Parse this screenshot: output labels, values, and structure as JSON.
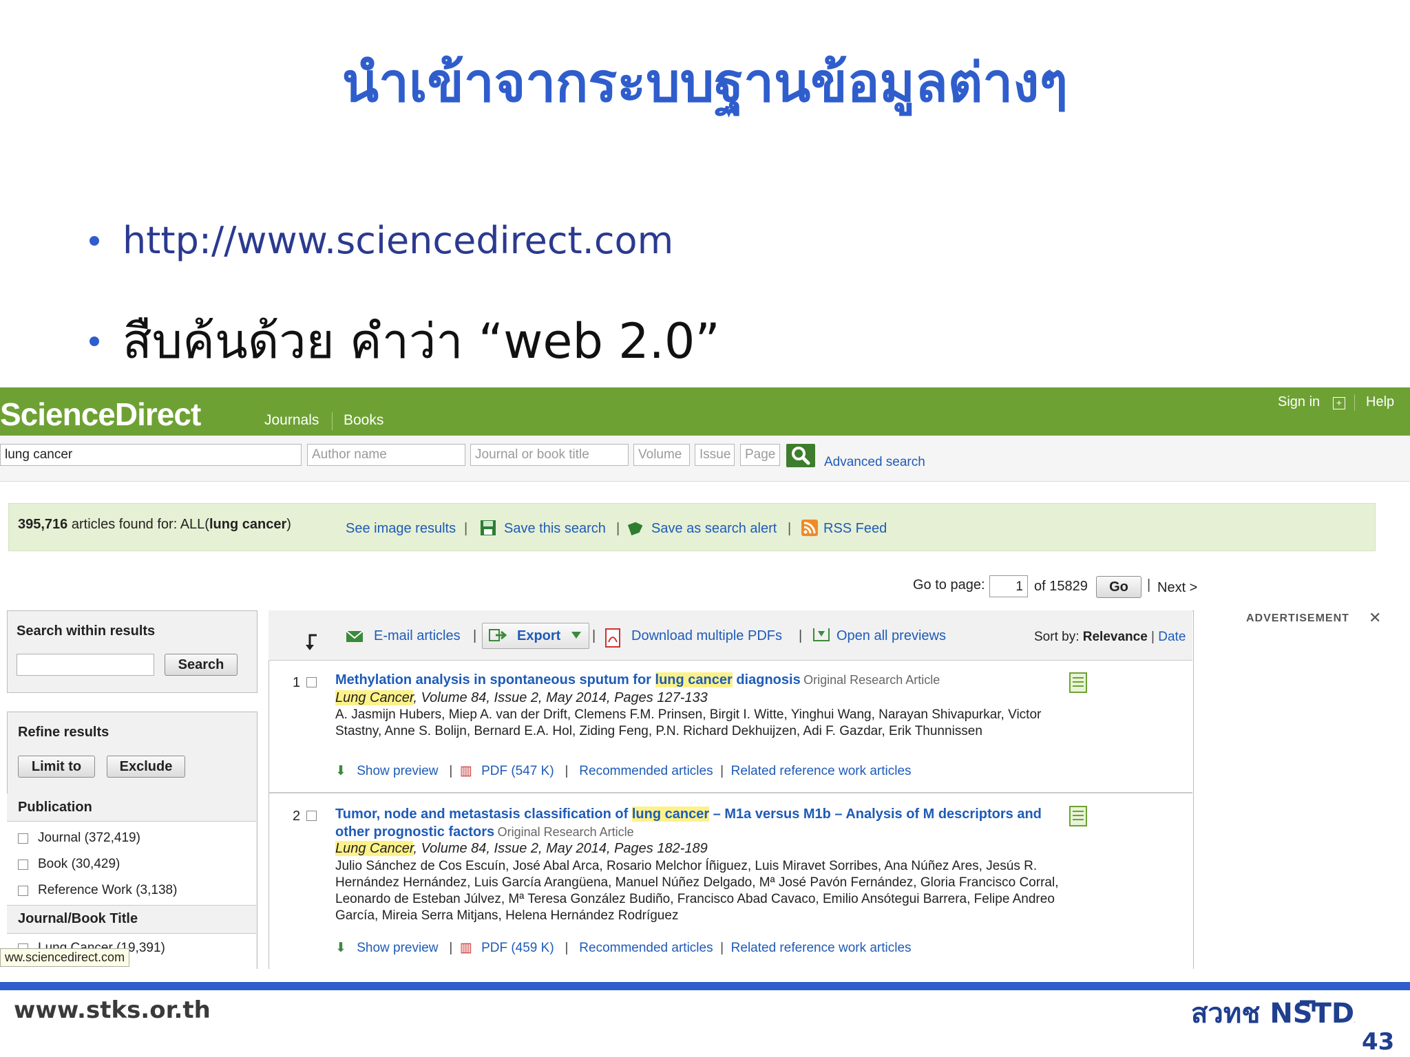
{
  "slide": {
    "title": "นำเข้าจากระบบฐานข้อมูลต่างๆ",
    "bullets": [
      "http://www.sciencedirect.com",
      "สืบค้นด้วย คำว่า “web 2.0”"
    ],
    "footer_url": "www.stks.or.th",
    "logo_text": "สวทช NSTDA",
    "page_number": "43"
  },
  "colors": {
    "title_blue": "#2f5dcc",
    "sd_green": "#6ea134",
    "link_blue": "#1e5bb8",
    "highlight": "#fdf28a"
  },
  "sd": {
    "logo": "ScienceDirect",
    "nav": [
      "Journals",
      "Books"
    ],
    "sign_in": "Sign in",
    "help": "Help",
    "search": {
      "terms_value": "lung cancer",
      "author_placeholder": "Author name",
      "journal_placeholder": "Journal or book title",
      "volume_placeholder": "Volume",
      "issue_placeholder": "Issue",
      "page_placeholder": "Page",
      "advanced": "Advanced search",
      "search_icon": "magnifier-icon"
    },
    "result_bar": {
      "count": "395,716",
      "found_for": " articles found for: ALL(",
      "query": "lung cancer",
      "close_paren": ")",
      "image_results": "See image results",
      "save_search": "Save this search",
      "save_alert": "Save as search alert",
      "rss": "RSS Feed"
    },
    "pager": {
      "go_to_page": "Go to page:",
      "current": "1",
      "of_total": "of 15829",
      "go": "Go",
      "next": "Next >"
    },
    "sidebar": {
      "within_title": "Search within results",
      "search_btn": "Search",
      "refine_title": "Refine results",
      "limit_btn": "Limit to",
      "exclude_btn": "Exclude",
      "publication_title": "Publication",
      "publication_items": [
        "Journal (372,419)",
        "Book (30,429)",
        "Reference Work (3,138)"
      ],
      "journal_title": "Journal/Book Title",
      "journal_items": [
        "Lung Cancer (19,391)"
      ]
    },
    "toolbar": {
      "email": "E-mail articles",
      "export": "Export",
      "download_pdfs": "Download multiple PDFs",
      "open_previews": "Open all previews",
      "sort_by": "Sort by: ",
      "relevance": "Relevance",
      "date": "Date"
    },
    "advertisement": "ADVERTISEMENT",
    "results": [
      {
        "num": "1",
        "title_pre": "Methylation analysis in spontaneous sputum for ",
        "title_hl": "lung cancer",
        "title_post": " diagnosis",
        "type": "Original Research Article",
        "journal_hl": "Lung Cancer",
        "journal_rest": ", Volume 84, Issue 2, May 2014, Pages 127-133",
        "authors": "A. Jasmijn Hubers, Miep A. van der Drift, Clemens F.M. Prinsen, Birgit I. Witte, Yinghui Wang, Narayan Shivapurkar, Victor Stastny, Anne S. Bolijn, Bernard E.A. Hol, Ziding Feng, P.N. Richard Dekhuijzen, Adi F. Gazdar, Erik Thunnissen",
        "preview": "Show preview",
        "pdf": "PDF (547 K)",
        "recommended": "Recommended articles",
        "related": "Related reference work articles"
      },
      {
        "num": "2",
        "title_pre": "Tumor, node and metastasis classification of ",
        "title_hl": "lung cancer",
        "title_post": " – M1a versus M1b – Analysis of M descriptors and other prognostic factors",
        "type": "Original Research Article",
        "journal_hl": "Lung Cancer",
        "journal_rest": ", Volume 84, Issue 2, May 2014, Pages 182-189",
        "authors": "Julio Sánchez de Cos Escuín, José Abal Arca, Rosario Melchor Íñiguez, Luis Miravet Sorribes, Ana Núñez Ares, Jesús R. Hernández Hernández, Luis García Arangüena, Manuel Núñez Delgado, Mª José Pavón Fernández, Gloria Francisco Corral, Leonardo de Esteban Júlvez, Mª Teresa González Budiño, Francisco Abad Cavaco, Emilio Ansótegui Barrera, Felipe Andreo García, Mireia Serra Mitjans, Helena Hernández Rodríguez",
        "preview": "Show preview",
        "pdf": "PDF (459 K)",
        "recommended": "Recommended articles",
        "related": "Related reference work articles"
      }
    ],
    "status_tip": "ww.sciencedirect.com"
  }
}
